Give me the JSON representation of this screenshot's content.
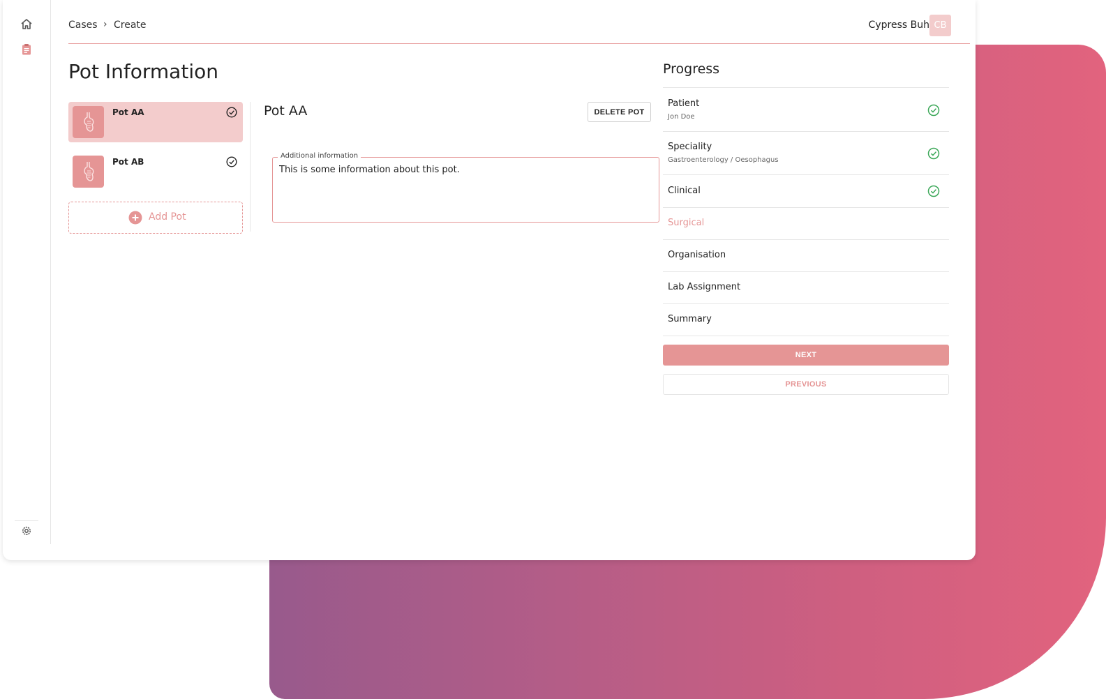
{
  "breadcrumb": {
    "items": [
      "Cases",
      "Create"
    ],
    "separator": "›"
  },
  "user": {
    "name": "Cypress Buh",
    "initials": "CB"
  },
  "page": {
    "title": "Pot Information"
  },
  "pots": [
    {
      "label": "Pot AA",
      "active": true,
      "complete": true
    },
    {
      "label": "Pot AB",
      "active": false,
      "complete": true
    }
  ],
  "add_pot": {
    "label": "Add Pot"
  },
  "detail": {
    "title": "Pot AA",
    "delete_label": "DELETE POT",
    "field_label": "Additional information",
    "field_value": "This is some information about this pot."
  },
  "progress": {
    "title": "Progress",
    "steps": [
      {
        "name": "Patient",
        "sub": "Jon Doe",
        "complete": true
      },
      {
        "name": "Speciality",
        "sub": "Gastroenterology / Oesophagus",
        "complete": true
      },
      {
        "name": "Clinical",
        "sub": "",
        "complete": true
      },
      {
        "name": "Surgical",
        "sub": "",
        "complete": false,
        "current": true
      },
      {
        "name": "Organisation",
        "sub": "",
        "complete": false
      },
      {
        "name": "Lab Assignment",
        "sub": "",
        "complete": false
      },
      {
        "name": "Summary",
        "sub": "",
        "complete": false
      }
    ],
    "next_label": "NEXT",
    "previous_label": "PREVIOUS"
  },
  "icons": {
    "nav": [
      "home-icon",
      "clipboard-icon",
      "gear-icon"
    ],
    "pot_thumb": "stomach-icon",
    "step_complete": "check-circle-icon",
    "add": "plus-circle-icon"
  },
  "colors": {
    "accent": "#e59595",
    "accent_light": "#f3cccc",
    "success": "#3aa757",
    "gradient_start": "#985a8c",
    "gradient_end": "#e2637e"
  }
}
